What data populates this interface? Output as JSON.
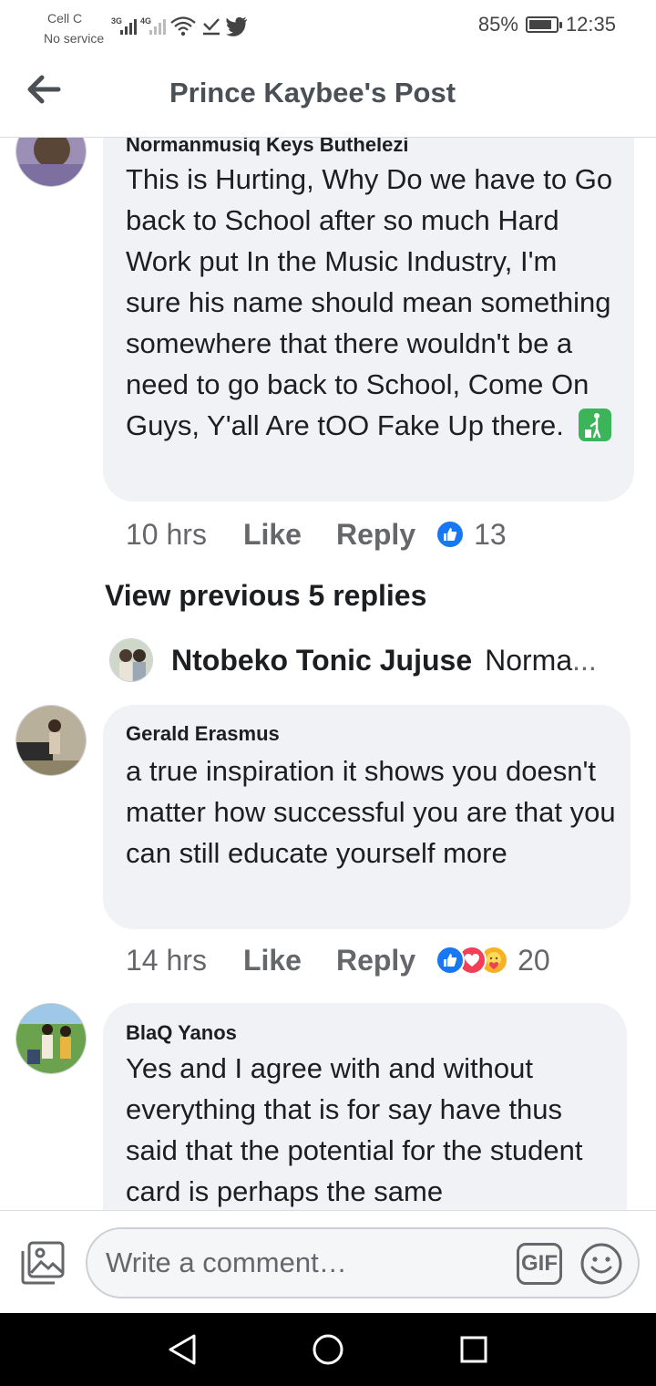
{
  "status_bar": {
    "carrier": "Cell C",
    "service": "No service",
    "net1": "3G",
    "net2": "4G",
    "battery": "85%",
    "battery_level": 0.85,
    "time": "12:35",
    "icons": [
      "signal-icon",
      "wifi-icon",
      "download-complete-icon",
      "twitter-icon"
    ]
  },
  "header": {
    "title": "Prince Kaybee's Post",
    "back_icon": "back-arrow-icon"
  },
  "comments": [
    {
      "author": "Normanmusiq Keys Buthelezi",
      "text": "This is Hurting, Why Do we have to Go back to School after so much Hard Work put In the Music Industry, I'm sure his name should mean something somewhere that there wouldn't be a need to go back to School, Come On Guys, Y'all Are tOO Fake Up there.",
      "emoji": "put-litter-in-bin-emoji",
      "time": "10 hrs",
      "like": "Like",
      "reply": "Reply",
      "reactions": [
        "like"
      ],
      "reaction_count": "13"
    },
    {
      "author": "Gerald Erasmus",
      "text": "a true inspiration it shows you doesn't matter how successful you are that you can still educate yourself more",
      "time": "14 hrs",
      "like": "Like",
      "reply": "Reply",
      "reactions": [
        "like",
        "love",
        "care"
      ],
      "reaction_count": "20"
    },
    {
      "author": "BlaQ Yanos",
      "text": "Yes and I agree with and without everything that is for say have thus said that the potential for the student card is perhaps the same"
    }
  ],
  "view_previous": "View previous 5 replies",
  "reply_preview": {
    "name": "Ntobeko Tonic Jujuse",
    "snippet": "Norma",
    "ellipsis": "..."
  },
  "composer": {
    "placeholder": "Write a comment…",
    "gif_label": "GIF"
  },
  "colors": {
    "accent": "#1877f2",
    "bubble": "#f0f2f5",
    "muted_text": "#65676b",
    "love": "#f33e58",
    "care": "#f7b125"
  }
}
